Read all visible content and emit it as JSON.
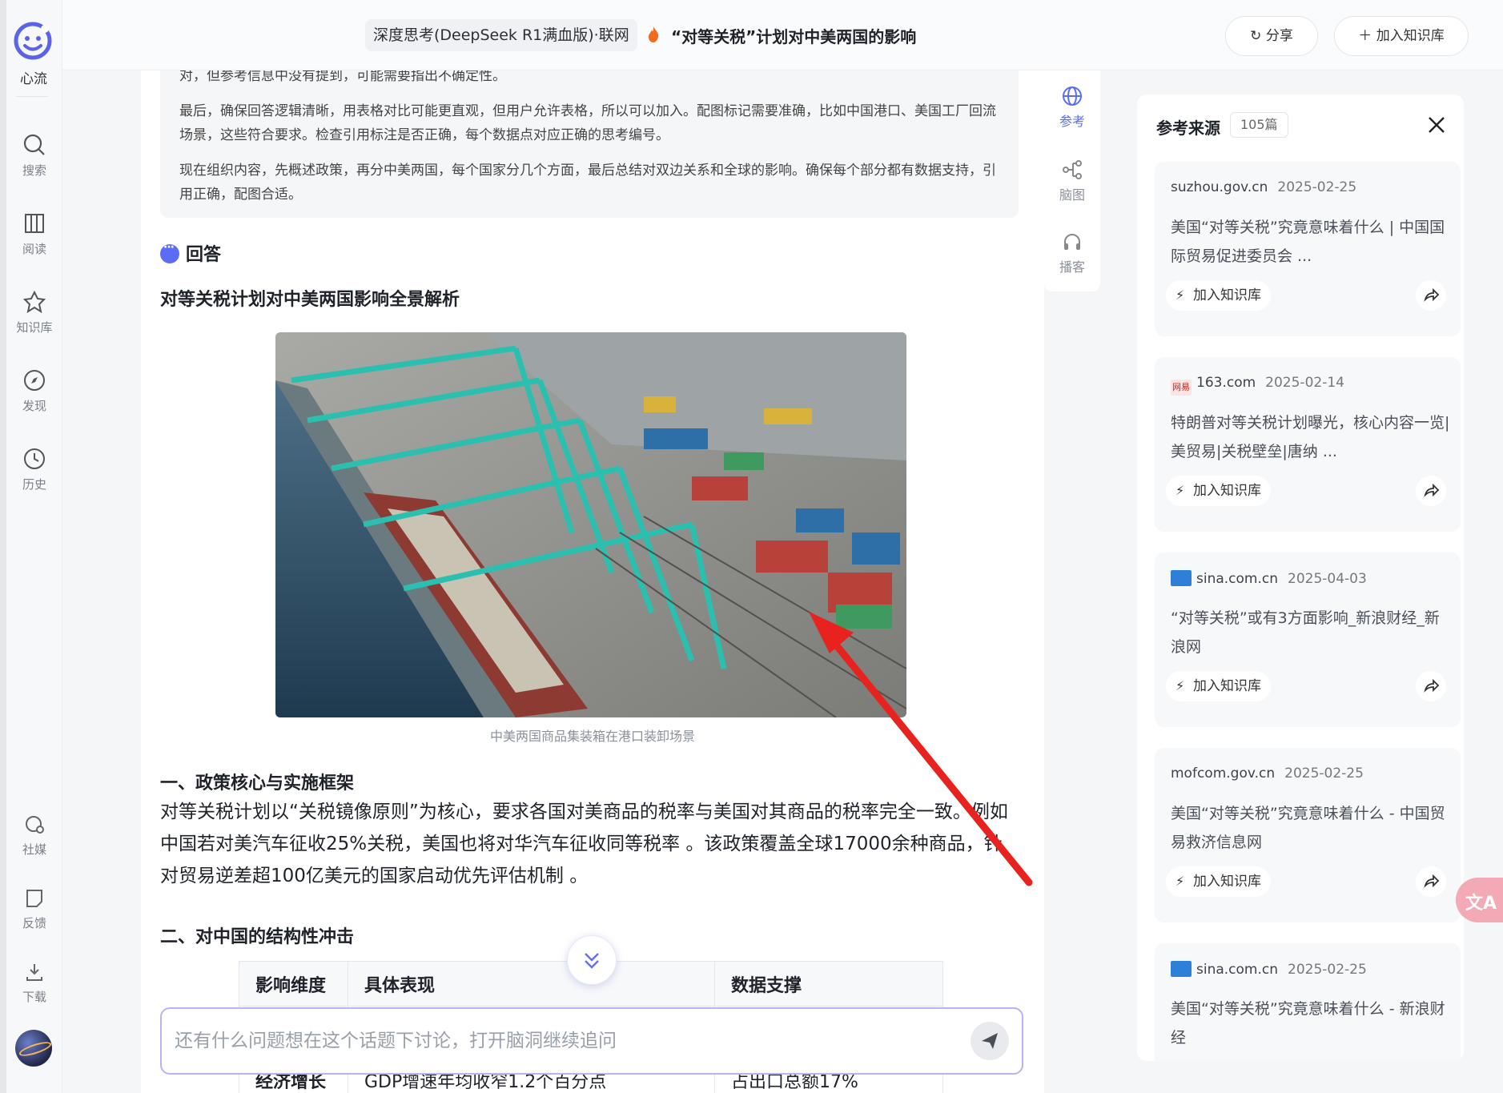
{
  "left_nav": {
    "logo_label": "心流",
    "items": [
      {
        "icon": "search-icon",
        "label": "搜索"
      },
      {
        "icon": "book-icon",
        "label": "阅读"
      },
      {
        "icon": "knowledge-icon",
        "label": "知识库"
      },
      {
        "icon": "compass-icon",
        "label": "发现"
      },
      {
        "icon": "clock-icon",
        "label": "历史"
      }
    ],
    "bottom_items": [
      {
        "icon": "social-icon",
        "label": "社媒"
      },
      {
        "icon": "feedback-icon",
        "label": "反馈"
      },
      {
        "icon": "download-icon",
        "label": "下载"
      }
    ]
  },
  "topbar": {
    "mode_chip": "深度思考(DeepSeek R1满血版)·联网",
    "topic": "“对等关税”计划对中美两国的影响",
    "share_label": "分享",
    "add_kb_label": "加入知识库"
  },
  "thinking": {
    "lines": [
      "对，但参考信息中没有提到，可能需要指出不确定性。",
      "最后，确保回答逻辑清晰，用表格对比可能更直观，但用户允许表格，所以可以加入。配图标记需要准确，比如中国港口、美国工厂回流场景，这些符合要求。检查引用标注是否正确，每个数据点对应正确的思考编号。",
      "现在组织内容，先概述政策，再分中美两国，每个国家分几个方面，最后总结对双边关系和全球的影响。确保每个部分都有数据支持，引用正确，配图合适。"
    ]
  },
  "answer": {
    "heading": "回答",
    "title": "对等关税计划对中美两国影响全景解析",
    "image_caption": "中美两国商品集装箱在港口装卸场景",
    "section1_title": "一、政策核心与实施框架",
    "section1_body": "对等关税计划以“关税镜像原则”为核心，要求各国对美商品的税率与美国对其商品的税率完全一致。例如中国若对美汽车征收25%关税，美国也将对华汽车征收同等税率 。该政策覆盖全球17000余种商品，针对贸易逆差超100亿美元的国家启动优先评估机制 。",
    "section2_title": "二、对中国的结构性冲击",
    "table": {
      "headers": [
        "影响维度",
        "具体表现",
        "数据支撑"
      ],
      "rows": [
        [
          "经济增长",
          "GDP增速年均收窄1.2个百分点",
          "占出口总额17%"
        ]
      ]
    }
  },
  "input": {
    "placeholder": "还有什么问题想在这个话题下讨论，打开脑洞继续追问"
  },
  "rail": {
    "items": [
      {
        "icon": "globe-icon",
        "label": "参考",
        "active": true
      },
      {
        "icon": "mindmap-icon",
        "label": "脑图",
        "active": false
      },
      {
        "icon": "headphones-icon",
        "label": "播客",
        "active": false
      }
    ]
  },
  "references": {
    "title": "参考来源",
    "count": "105篇",
    "add_label": "加入知识库",
    "items": [
      {
        "domain": "suzhou.gov.cn",
        "date": "2025-02-25",
        "title": "美国“对等关税”究竟意味着什么 | 中国国际贸易促进委员会 ...",
        "favicon": "none"
      },
      {
        "domain": "163.com",
        "date": "2025-02-14",
        "title": "特朗普对等关税计划曝光，核心内容一览|美贸易|关税壁垒|唐纳 ...",
        "favicon": "netease"
      },
      {
        "domain": "sina.com.cn",
        "date": "2025-04-03",
        "title": "“对等关税”或有3方面影响_新浪财经_新浪网",
        "favicon": "sina"
      },
      {
        "domain": "mofcom.gov.cn",
        "date": "2025-02-25",
        "title": "美国“对等关税”究竟意味着什么 - 中国贸易救济信息网",
        "favicon": "none"
      },
      {
        "domain": "sina.com.cn",
        "date": "2025-02-25",
        "title": "美国“对等关税”究竟意味着什么 - 新浪财经",
        "favicon": "sina"
      }
    ]
  },
  "colors": {
    "accent": "#5a6cf3",
    "arrow": "#e8231f"
  }
}
